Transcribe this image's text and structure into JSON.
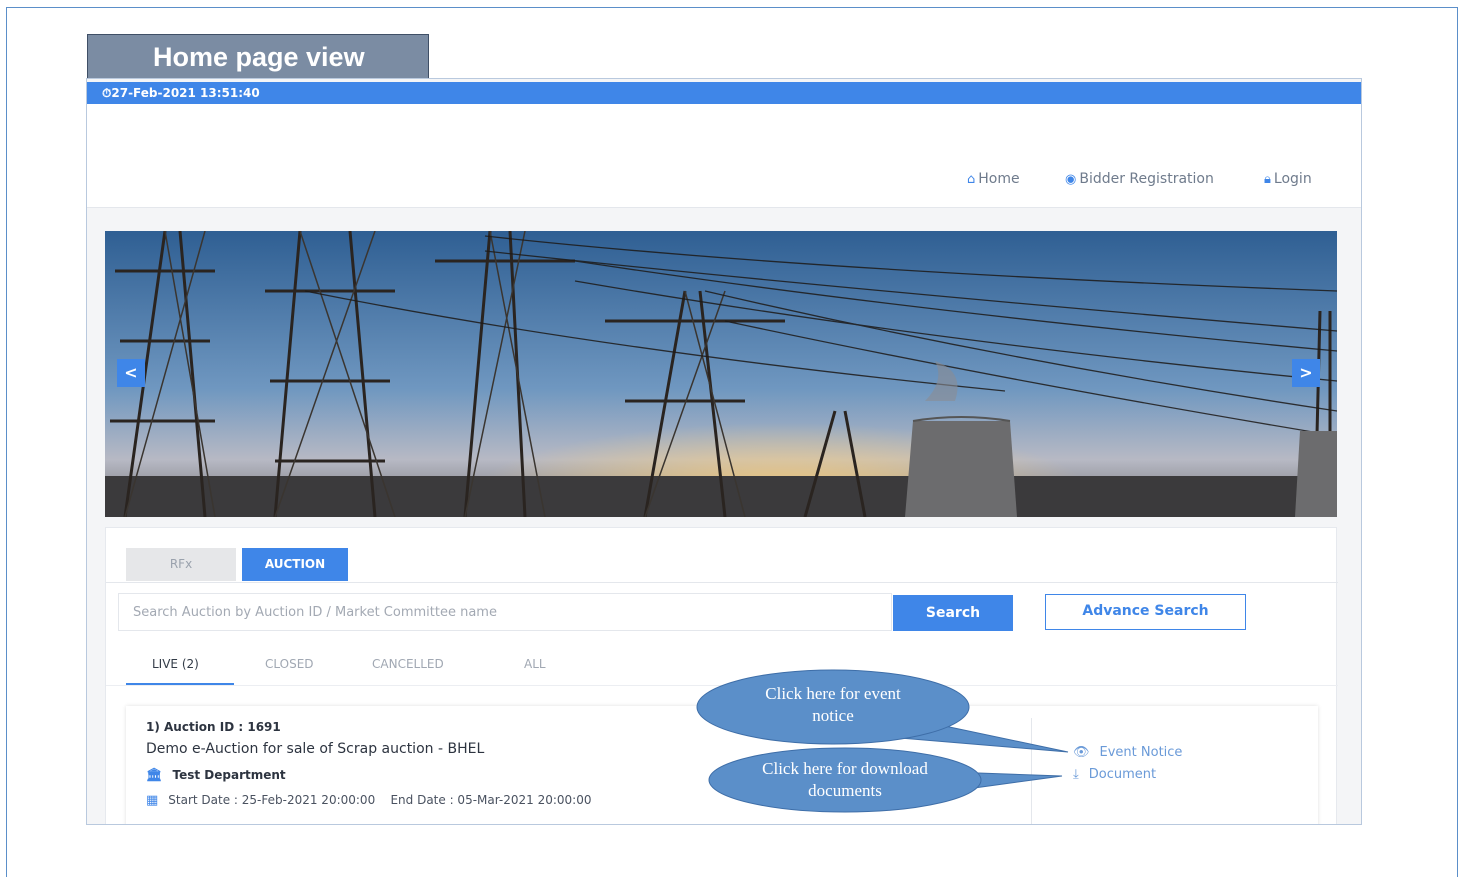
{
  "caption": "Home page view",
  "topbar": {
    "datetime": "27-Feb-2021 13:51:40",
    "clock_icon": "clock-icon"
  },
  "nav": {
    "home": "Home",
    "bidder_registration": "Bidder Registration",
    "login": "Login",
    "home_icon": "home-icon",
    "user_icon": "user-circle-icon",
    "lock_icon": "lock-icon"
  },
  "hero": {
    "prev_icon": "<",
    "next_icon": ">"
  },
  "tabs": {
    "rfx": "RFx",
    "auction": "AUCTION",
    "active": "AUCTION"
  },
  "search": {
    "placeholder": "Search Auction by Auction ID / Market Committee name",
    "value": "",
    "button": "Search",
    "advance_button": "Advance Search"
  },
  "subtabs": {
    "live": "LIVE (2)",
    "closed": "CLOSED",
    "cancelled": "CANCELLED",
    "all": "ALL",
    "active": "LIVE (2)"
  },
  "auction": {
    "id_line": "1) Auction ID : 1691",
    "title": "Demo e-Auction for sale of Scrap auction - BHEL",
    "department": "Test Department",
    "dates": "Start Date : 25-Feb-2021 20:00:00    End Date : 05-Mar-2021 20:00:00",
    "event_notice": "Event Notice",
    "document": "Document"
  },
  "callouts": {
    "event_notice": "Click here for event notice",
    "download": "Click here for download documents",
    "color": "#5b8fc9"
  },
  "colors": {
    "accent": "#3f86e8",
    "frame": "#5b8fc9",
    "caption_bg": "#7b8ca3"
  }
}
